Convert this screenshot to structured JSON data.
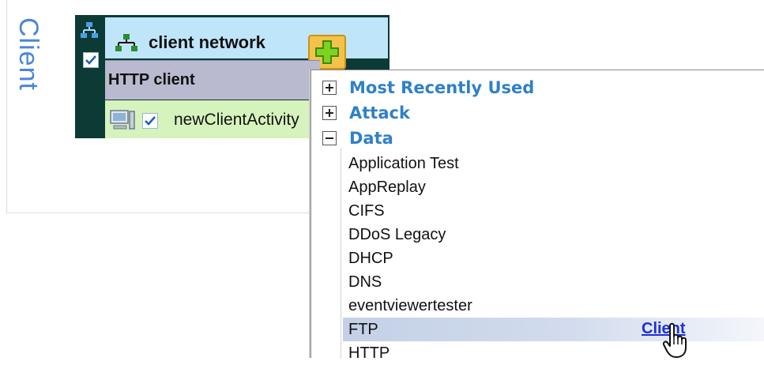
{
  "panel": {
    "vertical_label": "Client"
  },
  "network": {
    "title": "client network",
    "section_label": "HTTP client",
    "activity_label": "newClientActivity"
  },
  "menu": {
    "categories": [
      {
        "label": "Most Recently Used",
        "state": "collapsed"
      },
      {
        "label": "Attack",
        "state": "collapsed"
      },
      {
        "label": "Data",
        "state": "expanded"
      }
    ],
    "items": [
      {
        "label": "Application Test"
      },
      {
        "label": "AppReplay"
      },
      {
        "label": "CIFS"
      },
      {
        "label": "DDoS Legacy"
      },
      {
        "label": "DHCP"
      },
      {
        "label": "DNS"
      },
      {
        "label": "eventviewertester"
      },
      {
        "label": "FTP",
        "hover_link": "Client"
      },
      {
        "label": "HTTP"
      }
    ]
  },
  "colors": {
    "accent_blue": "#2f80c8",
    "dark_teal": "#0c3a35",
    "header_light_blue": "#bfe5fb",
    "activity_green": "#d6f3bd",
    "section_gray": "#b9b9cf",
    "add_button_yellow": "#f4c24a",
    "link_blue": "#1d2fd8"
  },
  "icons": {
    "network_small": "network-icon",
    "network_header": "network-tree-icon",
    "add": "plus-icon",
    "activity": "computer-icon",
    "checkbox": "checkmark-icon",
    "cursor": "hand-cursor-icon"
  }
}
